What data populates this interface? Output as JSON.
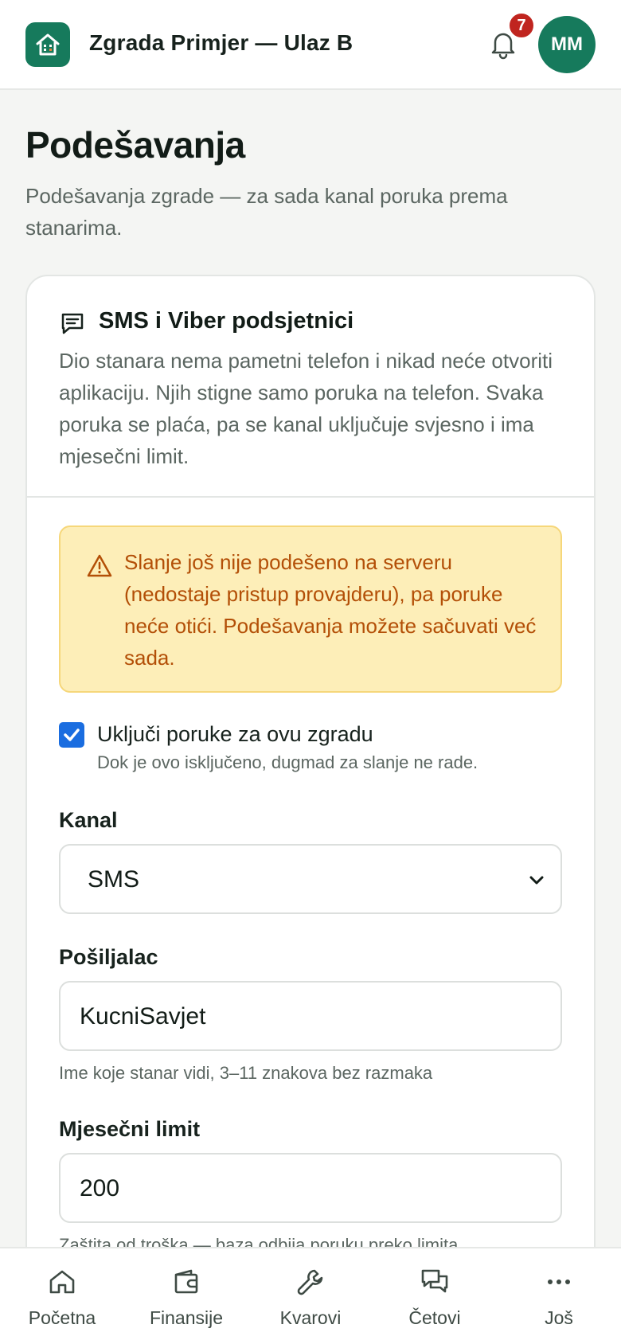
{
  "header": {
    "app_title": "Zgrada Primjer — Ulaz B",
    "notification_count": "7",
    "avatar_initials": "MM"
  },
  "page": {
    "title": "Podešavanja",
    "subtitle": "Podešavanja zgrade — za sada kanal poruka prema stanarima."
  },
  "card": {
    "title": "SMS i Viber podsjetnici",
    "description": "Dio stanara nema pametni telefon i nikad neće otvoriti aplikaciju. Njih stigne samo poruka na telefon. Svaka poruka se plaća, pa se kanal uključuje svjesno i ima mjesečni limit.",
    "warning": "Slanje još nije podešeno na serveru (nedostaje pristup provajderu), pa poruke neće otići. Podešavanja možete sačuvati već sada.",
    "enable": {
      "label": "Uključi poruke za ovu zgradu",
      "hint": "Dok je ovo isključeno, dugmad za slanje ne rade.",
      "checked": true
    },
    "channel": {
      "label": "Kanal",
      "value": "SMS"
    },
    "sender": {
      "label": "Pošiljalac",
      "value": "KucniSavjet",
      "hint": "Ime koje stanar vidi, 3–11 znakova bez razmaka"
    },
    "limit": {
      "label": "Mjesečni limit",
      "value": "200",
      "hint": "Zaštita od troška — baza odbija poruku preko limita."
    }
  },
  "nav": {
    "items": [
      {
        "label": "Početna",
        "icon": "home-icon"
      },
      {
        "label": "Finansije",
        "icon": "wallet-icon"
      },
      {
        "label": "Kvarovi",
        "icon": "wrench-icon"
      },
      {
        "label": "Četovi",
        "icon": "chat-icon"
      },
      {
        "label": "Još",
        "icon": "more-icon"
      }
    ]
  },
  "colors": {
    "brand": "#167a5c",
    "badge": "#c0251f",
    "warning_bg": "#fdeeb8",
    "warning_text": "#b34f07",
    "checkbox": "#1a6de0"
  }
}
